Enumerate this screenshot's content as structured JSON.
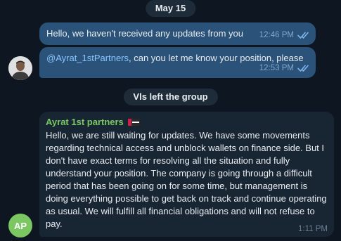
{
  "date_separator": "May 15",
  "messages_out": [
    {
      "text": "Hello, we haven't received any updates from you",
      "time": "12:46 PM",
      "status": "read"
    },
    {
      "mention": "@Ayrat_1stPartners",
      "text": ", can you let me know your position, please",
      "time": "12:53 PM",
      "status": "read"
    }
  ],
  "system_event": "Vls left the group",
  "message_in": {
    "sender": "Ayrat 1st partners",
    "sender_initials": "AP",
    "text": "Hello, we are still waiting for updates. We have some movements regarding technical access and unblock wallets on finance side. But I don't have exact terms for resolving all the situation and fully understand your position. The company is going through a difficult period that has been going on for some time, but management is doing everything possible to get back on track and continue operating as usual. We will fulfill all financial obligations and will not refuse to pay.",
    "time": "1:11 PM"
  },
  "colors": {
    "background": "#0e1621",
    "outgoing_bubble": "#2b5278",
    "incoming_bubble": "#182533",
    "sender_name": "#7bc862",
    "mention": "#8ac4ff",
    "check_marks": "#7fb6f0"
  },
  "icons": {
    "read_status": "double-check-icon",
    "sender_badge": "flag-icon"
  }
}
